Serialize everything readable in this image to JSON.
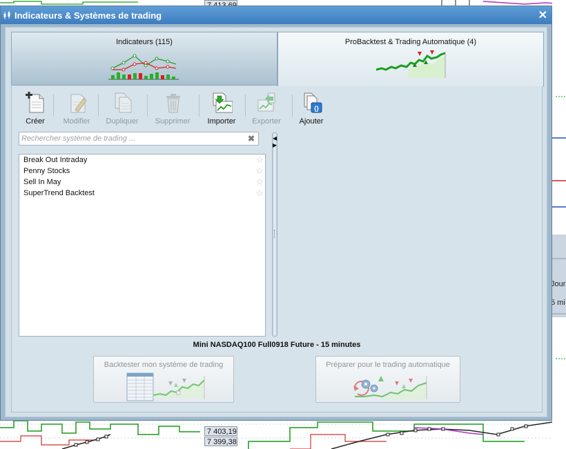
{
  "background": {
    "prices": [
      "7 413,69",
      "7 403,19",
      "7 399,38"
    ],
    "side_labels": [
      "Jour",
      "5 mi"
    ]
  },
  "dialog": {
    "title": "Indicateurs & Systèmes de trading",
    "close_glyph": "✕"
  },
  "tabs": [
    {
      "label": "Indicateurs (115)",
      "active": false
    },
    {
      "label": "ProBacktest & Trading Automatique (4)",
      "active": true
    }
  ],
  "toolbar": {
    "create": "Créer",
    "modify": "Modifier",
    "duplicate": "Dupliquer",
    "delete": "Supprimer",
    "import": "Importer",
    "export": "Exporter",
    "add": "Ajouter"
  },
  "search": {
    "placeholder": "Rechercher système de trading ...",
    "value": ""
  },
  "systems": [
    {
      "name": "Break Out Intraday"
    },
    {
      "name": "Penny Stocks"
    },
    {
      "name": "Sell In May"
    },
    {
      "name": "SuperTrend Backtest"
    }
  ],
  "instrument": "Mini NASDAQ100 Full0918 Future - 15 minutes",
  "actions": {
    "backtest": "Backtester mon système de trading",
    "automatic": "Préparer pour le trading automatique"
  },
  "colors": {
    "title_bar": "#3d7dbf",
    "accent_green": "#2ea32e",
    "arrow_red": "#e02020"
  }
}
